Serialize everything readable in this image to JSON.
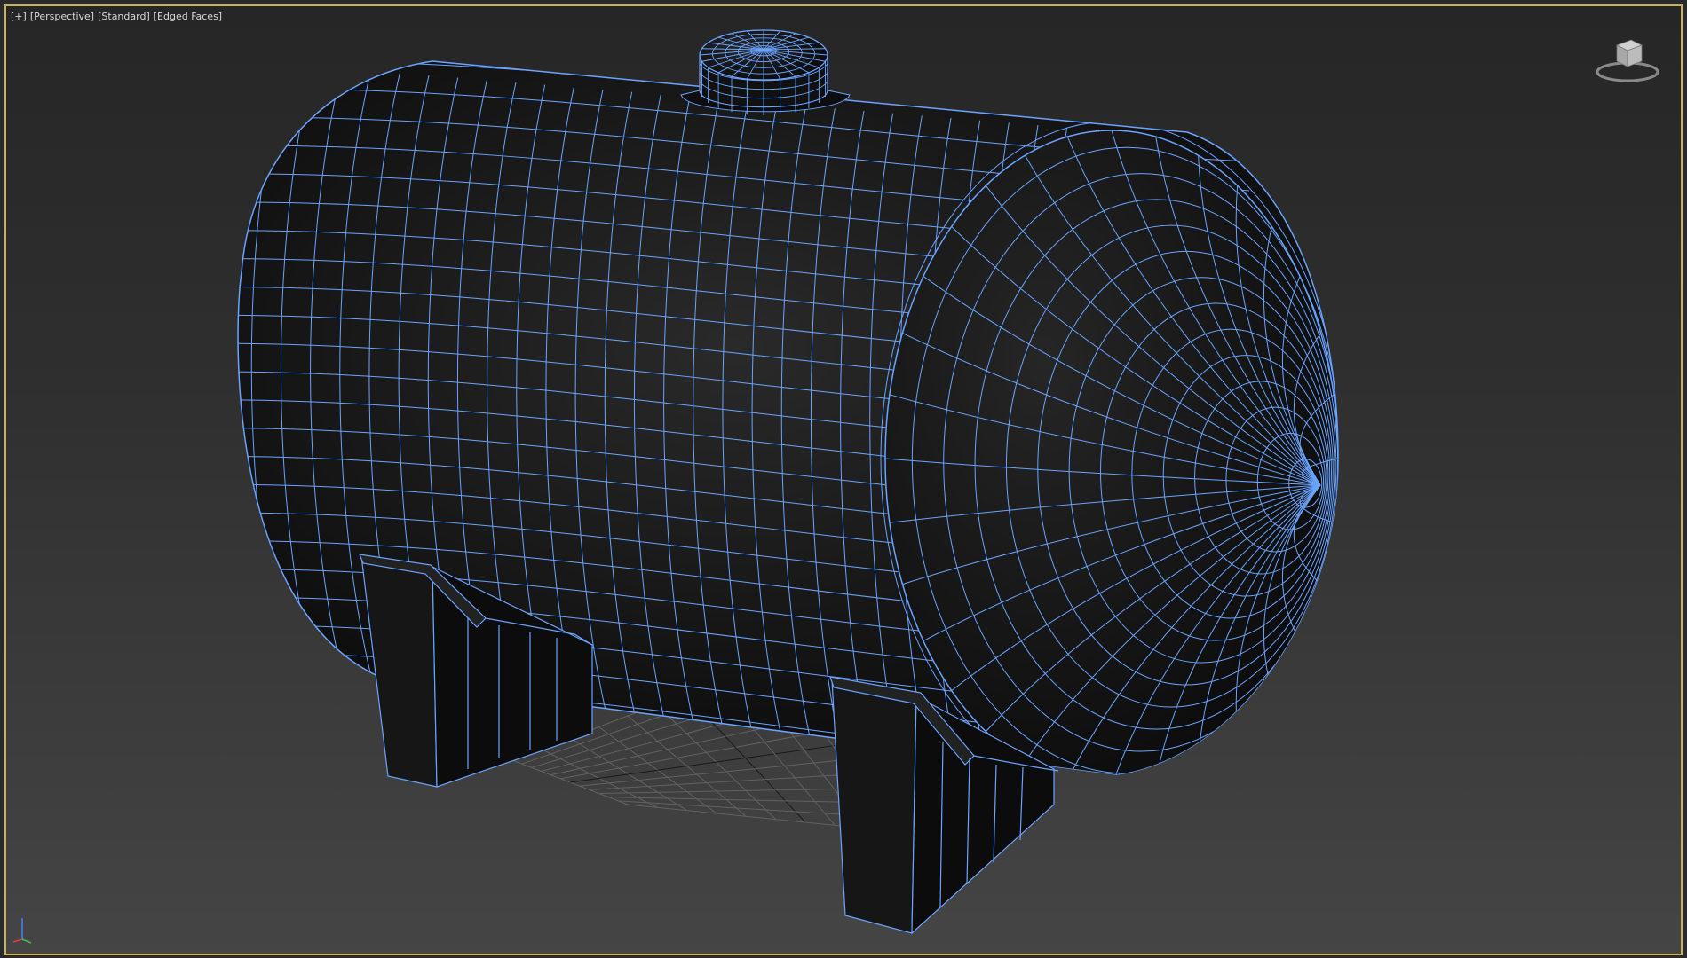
{
  "viewport": {
    "label_plus": "[+]",
    "label_view": "[Perspective]",
    "label_shading": "[Standard]",
    "label_edges": "[Edged Faces]"
  },
  "colors": {
    "wire": "#6aa4ff",
    "frame": "#c8b25a",
    "mesh": "#141414",
    "grid": "#6a6a6a"
  },
  "icons": {
    "viewcube": "viewcube-icon",
    "axis": "axis-tripod-icon"
  }
}
